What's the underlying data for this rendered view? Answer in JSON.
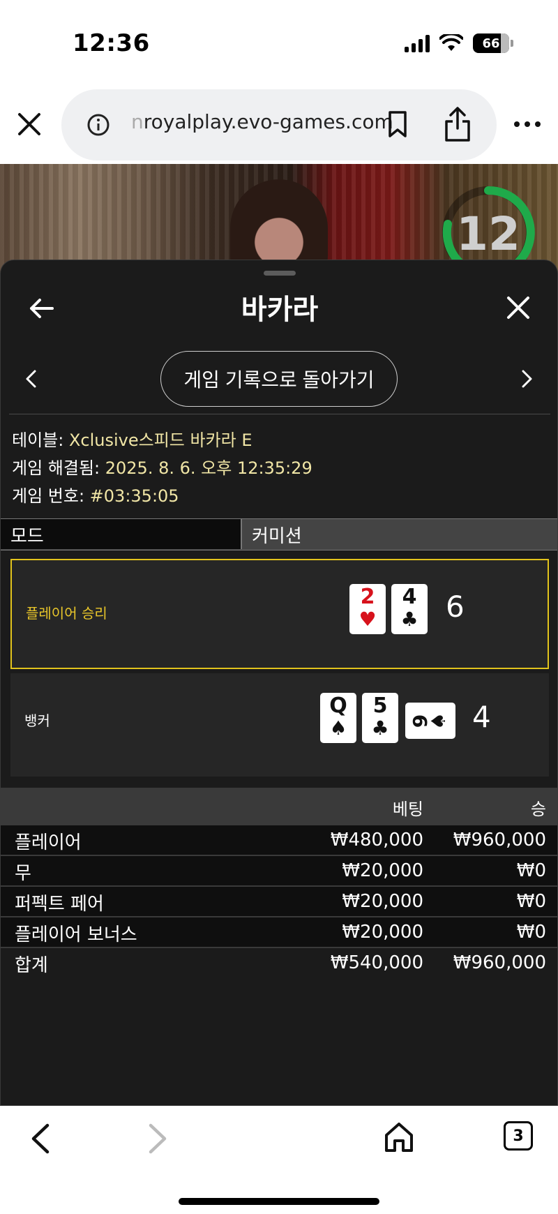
{
  "status_bar": {
    "time": "12:36",
    "battery": "66"
  },
  "browser": {
    "url_prefix": "n",
    "url": "royalplay.evo-games.com",
    "tab_count": "3"
  },
  "video": {
    "timer": "12"
  },
  "panel": {
    "title": "바카라",
    "back_history_label": "게임 기록으로 돌아가기",
    "meta": {
      "table_label": "테이블: ",
      "table_value": "Xclusive스피드 바카라 E",
      "resolved_label": "게임 해결됨: ",
      "resolved_value": "2025. 8. 6. 오후 12:35:29",
      "game_no_label": "게임 번호: ",
      "game_no_value": "#03:35:05"
    },
    "mode": {
      "label": "모드",
      "value": "커미션"
    },
    "player": {
      "label": "플레이어 승리",
      "cards": [
        {
          "rank": "2",
          "suit": "♥"
        },
        {
          "rank": "4",
          "suit": "♣"
        }
      ],
      "score": "6"
    },
    "banker": {
      "label": "뱅커",
      "cards": [
        {
          "rank": "Q",
          "suit": "♠"
        },
        {
          "rank": "5",
          "suit": "♣"
        },
        {
          "rank": "9",
          "suit": "♠"
        }
      ],
      "score": "4"
    },
    "bets": {
      "header_bet": "베팅",
      "header_win": "승",
      "rows": [
        {
          "name": "플레이어",
          "bet": "₩480,000",
          "win": "₩960,000"
        },
        {
          "name": "무",
          "bet": "₩20,000",
          "win": "₩0"
        },
        {
          "name": "퍼펙트 페어",
          "bet": "₩20,000",
          "win": "₩0"
        },
        {
          "name": "플레이어 보너스",
          "bet": "₩20,000",
          "win": "₩0"
        }
      ],
      "total": {
        "name": "합계",
        "bet": "₩540,000",
        "win": "₩960,000"
      }
    }
  },
  "colors": {
    "accent": "#e2c31c",
    "meta_value": "#f1e6a6",
    "panel_bg": "#1b1b1b",
    "timer_ring": "#1faa4a",
    "heart": "#d7121c"
  }
}
